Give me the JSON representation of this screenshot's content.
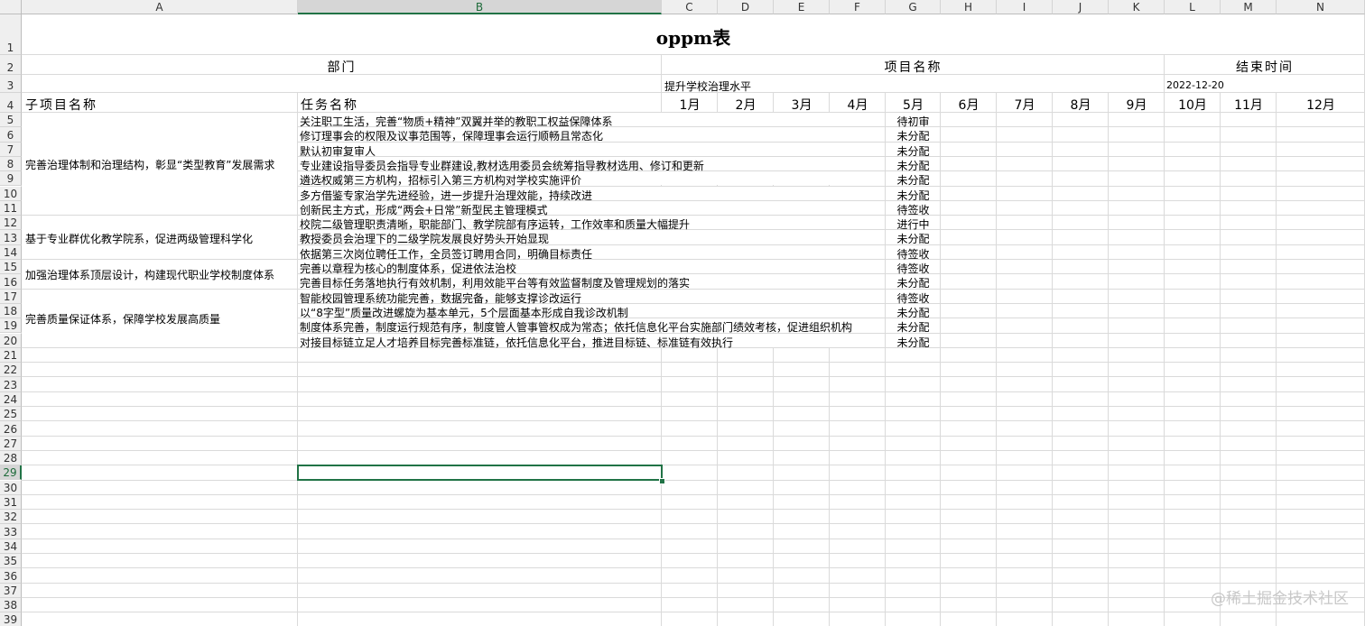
{
  "columns": [
    "A",
    "B",
    "C",
    "D",
    "E",
    "F",
    "G",
    "H",
    "I",
    "J",
    "K",
    "L",
    "M",
    "N"
  ],
  "selected_column": "B",
  "rows": [
    "1",
    "2",
    "3",
    "4",
    "5",
    "6",
    "7",
    "8",
    "9",
    "10",
    "11",
    "12",
    "13",
    "14",
    "15",
    "16",
    "17",
    "18",
    "19",
    "20",
    "21",
    "22",
    "23",
    "24",
    "25",
    "26",
    "27",
    "28",
    "29",
    "30",
    "31",
    "32",
    "33",
    "34",
    "35",
    "36",
    "37",
    "38",
    "39"
  ],
  "selected_row": "29",
  "title": "oppm表",
  "labels": {
    "department": "部门",
    "project_name": "项目名称",
    "end_time": "结束时间",
    "project_value": "提升学校治理水平",
    "end_date": "2022-12-20",
    "subproject_header": "子项目名称",
    "task_header": "任务名称"
  },
  "months": [
    "1月",
    "2月",
    "3月",
    "4月",
    "5月",
    "6月",
    "7月",
    "8月",
    "9月",
    "10月",
    "11月",
    "12月"
  ],
  "subprojects": [
    "完善治理体制和治理结构，彰显“类型教育”发展需求",
    "基于专业群优化教学院系，促进两级管理科学化",
    "加强治理体系顶层设计，构建现代职业学校制度体系",
    "完善质量保证体系，保障学校发展高质量"
  ],
  "tasks": [
    {
      "name": "关注职工生活，完善“物质+精神”双翼并举的教职工权益保障体系",
      "status": "待初审"
    },
    {
      "name": "修订理事会的权限及议事范围等，保障理事会运行顺畅且常态化",
      "status": "未分配"
    },
    {
      "name": "默认初审复审人",
      "status": "未分配"
    },
    {
      "name": "专业建设指导委员会指导专业群建设,教材选用委员会统筹指导教材选用、修订和更新",
      "status": "未分配"
    },
    {
      "name": "遴选权威第三方机构，招标引入第三方机构对学校实施评价",
      "status": "未分配"
    },
    {
      "name": "多方借鉴专家治学先进经验，进一步提升治理效能，持续改进",
      "status": "未分配"
    },
    {
      "name": "创新民主方式，形成“两会+日常”新型民主管理模式",
      "status": "待签收"
    },
    {
      "name": "校院二级管理职责清晰，职能部门、教学院部有序运转，工作效率和质量大幅提升",
      "status": "进行中"
    },
    {
      "name": "教授委员会治理下的二级学院发展良好势头开始显现",
      "status": "未分配"
    },
    {
      "name": "依据第三次岗位聘任工作，全员签订聘用合同，明确目标责任",
      "status": "待签收"
    },
    {
      "name": "完善以章程为核心的制度体系，促进依法治校",
      "status": "待签收"
    },
    {
      "name": "完善目标任务落地执行有效机制，利用效能平台等有效监督制度及管理规划的落实",
      "status": "未分配"
    },
    {
      "name": "智能校园管理系统功能完善，数据完备，能够支撑诊改运行",
      "status": "待签收"
    },
    {
      "name": "以“8字型”质量改进螺旋为基本单元，5个层面基本形成自我诊改机制",
      "status": "未分配"
    },
    {
      "name": "制度体系完善，制度运行规范有序，制度管人管事管权成为常态；依托信息化平台实施部门绩效考核，促进组织机构",
      "status": "未分配"
    },
    {
      "name": "对接目标链立足人才培养目标完善标准链，依托信息化平台，推进目标链、标准链有效执行",
      "status": "未分配"
    }
  ],
  "watermark": "@稀土掘金技术社区"
}
